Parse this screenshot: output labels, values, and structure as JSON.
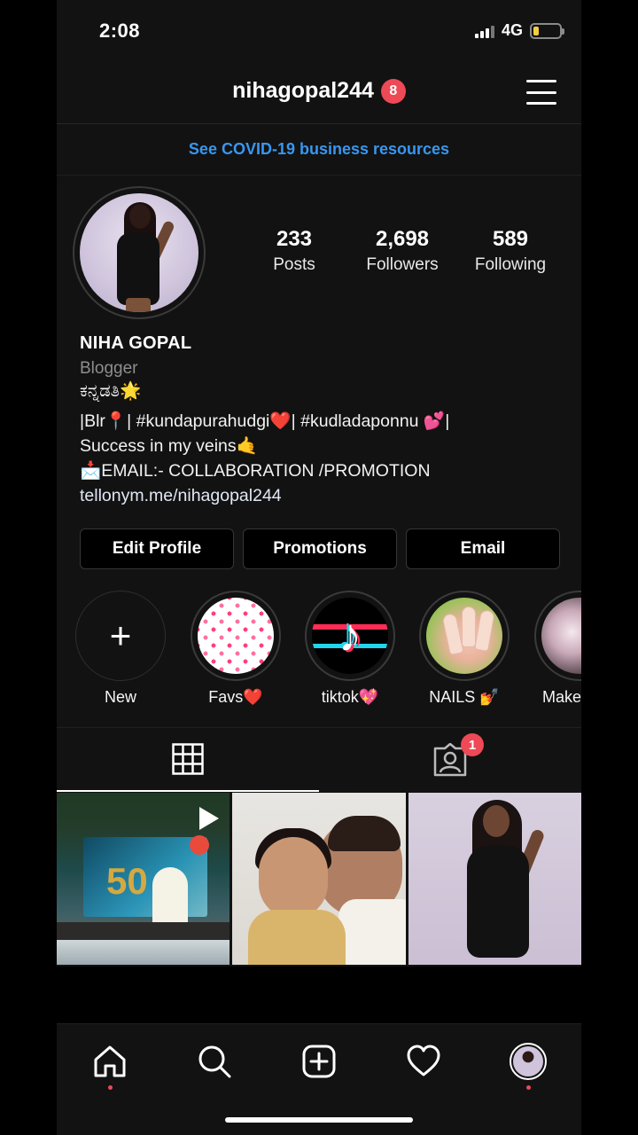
{
  "status_bar": {
    "time": "2:08",
    "network": "4G",
    "battery_level": 0.22
  },
  "header": {
    "username": "nihagopal244",
    "notification_count": "8"
  },
  "banner": {
    "text": "See COVID-19 business resources"
  },
  "stats": {
    "posts": {
      "value": "233",
      "label": "Posts"
    },
    "followers": {
      "value": "2,698",
      "label": "Followers"
    },
    "following": {
      "value": "589",
      "label": "Following"
    }
  },
  "bio": {
    "name": "NIHA GOPAL",
    "category": "Blogger",
    "line1": "ಕನ್ನಡತಿ🌟",
    "line2": "|Blr📍| #kundapurahudgi❤️| #kudladaponnu 💕|",
    "line3": "Success in my veins🤙",
    "line4": "📩EMAIL:- COLLABORATION /PROMOTION",
    "link": "tellonym.me/nihagopal244"
  },
  "actions": {
    "edit": "Edit Profile",
    "promotions": "Promotions",
    "email": "Email"
  },
  "highlights": [
    {
      "label": "New"
    },
    {
      "label": "Favs❤️"
    },
    {
      "label": "tiktok💖"
    },
    {
      "label": "NAILS 💅"
    },
    {
      "label": "Make u"
    }
  ],
  "tabs": {
    "tagged_count": "1"
  },
  "colors": {
    "accent": "#3897f0",
    "badge": "#ed4956",
    "background": "#121212"
  },
  "icons": [
    "menu-icon",
    "plus-icon",
    "grid-icon",
    "tagged-icon",
    "reel-icon",
    "home-icon",
    "search-icon",
    "new-post-icon",
    "heart-icon"
  ]
}
